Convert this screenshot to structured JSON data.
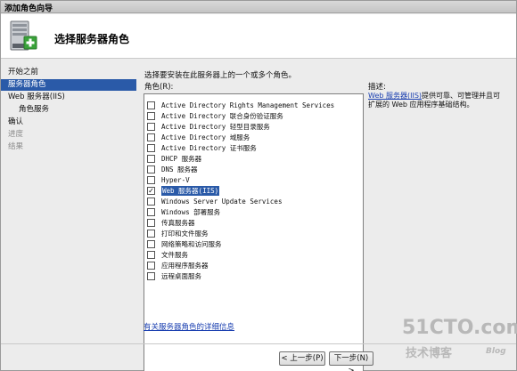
{
  "window": {
    "title": "添加角色向导"
  },
  "header": {
    "title": "选择服务器角色",
    "icon": "server-add-icon"
  },
  "nav": {
    "items": [
      {
        "label": "开始之前",
        "state": "normal"
      },
      {
        "label": "服务器角色",
        "state": "selected"
      },
      {
        "label": "Web 服务器(IIS)",
        "state": "normal"
      },
      {
        "label": "角色服务",
        "state": "sub"
      },
      {
        "label": "确认",
        "state": "normal"
      },
      {
        "label": "进度",
        "state": "disabled"
      },
      {
        "label": "结果",
        "state": "disabled"
      }
    ]
  },
  "content": {
    "instruction": "选择要安装在此服务器上的一个或多个角色。",
    "roles_label": "角色(R):",
    "roles": [
      {
        "label": "Active Directory Rights Management Services",
        "checked": false
      },
      {
        "label": "Active Directory 联合身份验证服务",
        "checked": false
      },
      {
        "label": "Active Directory 轻型目录服务",
        "checked": false
      },
      {
        "label": "Active Directory 域服务",
        "checked": false
      },
      {
        "label": "Active Directory 证书服务",
        "checked": false
      },
      {
        "label": "DHCP 服务器",
        "checked": false
      },
      {
        "label": "DNS 服务器",
        "checked": false
      },
      {
        "label": "Hyper-V",
        "checked": false
      },
      {
        "label": "Web 服务器(IIS)",
        "checked": true
      },
      {
        "label": "Windows Server Update Services",
        "checked": false
      },
      {
        "label": "Windows 部署服务",
        "checked": false
      },
      {
        "label": "传真服务器",
        "checked": false
      },
      {
        "label": "打印和文件服务",
        "checked": false
      },
      {
        "label": "网络策略和访问服务",
        "checked": false
      },
      {
        "label": "文件服务",
        "checked": false
      },
      {
        "label": "应用程序服务器",
        "checked": false
      },
      {
        "label": "远程桌面服务",
        "checked": false
      }
    ],
    "description": {
      "title": "描述:",
      "link": "Web 服务器(IIS)",
      "text": "提供可靠、可管理并且可扩展的 Web 应用程序基础结构。"
    },
    "more_info": "有关服务器角色的详细信息"
  },
  "buttons": {
    "back": "< 上一步(P)",
    "next": "下一步(N) >"
  },
  "watermark": {
    "site": "51CTO.com",
    "sub": "技术博客",
    "blog": "Blog"
  },
  "colors": {
    "selection": "#2a5aa8",
    "link": "#1a3fb0"
  }
}
